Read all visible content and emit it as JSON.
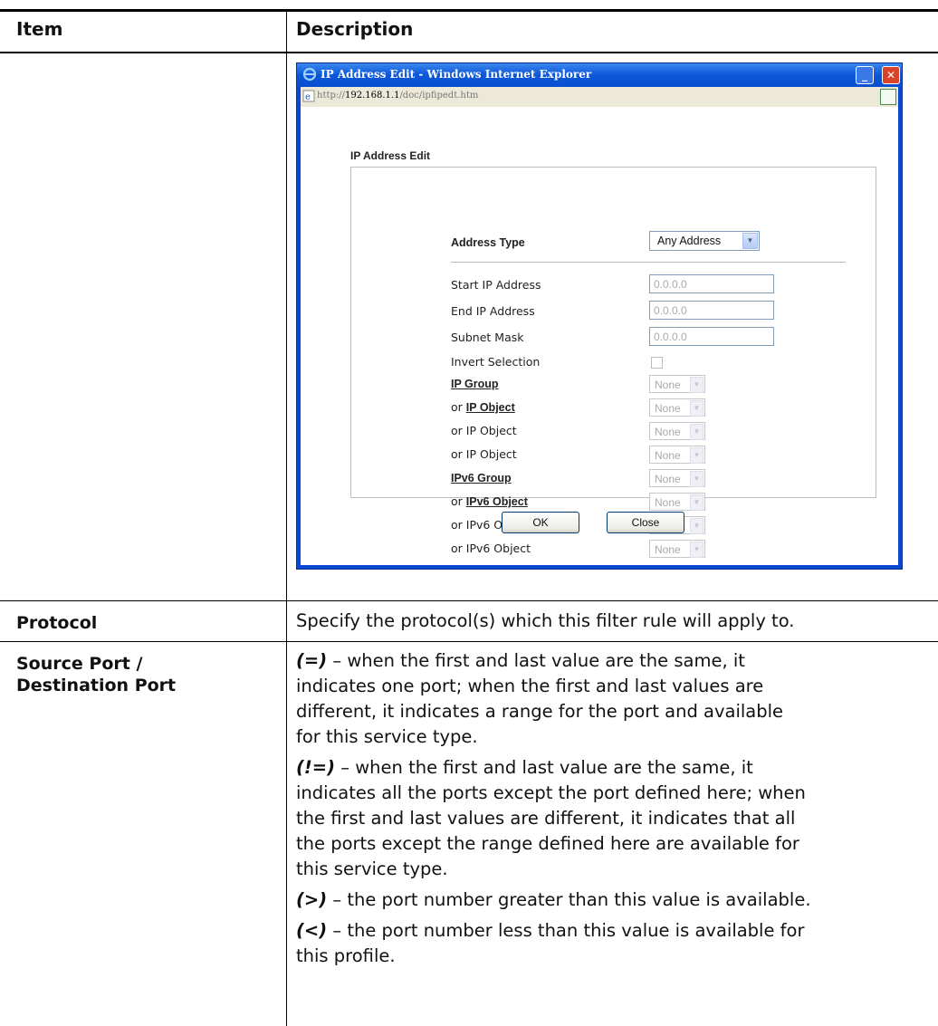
{
  "table": {
    "headers": [
      "Item",
      "Description"
    ],
    "rows": [
      {
        "item": "Protocol",
        "description": "Specify the protocol(s) which this filter rule will apply to."
      },
      {
        "item_lines": [
          "Source Port /",
          "Destination Port"
        ],
        "entries": [
          {
            "symbol": "(=)",
            "lines": [
              "– when the first and last value are the same, it",
              "indicates one port; when the first and last values are",
              "different, it indicates a range for the port and available",
              "for this service type."
            ]
          },
          {
            "symbol": "(!=)",
            "lines": [
              "– when the first and last value are the same, it",
              "indicates all the ports except the port defined here; when",
              "the first and last values are different, it indicates that all",
              "the ports except the range defined here are available for",
              "this service type."
            ]
          },
          {
            "symbol": "(>)",
            "lines": [
              "– the port number greater than this value is available."
            ]
          },
          {
            "symbol": "(<)",
            "lines": [
              "– the port number less than this value is available for",
              "this profile."
            ]
          }
        ]
      }
    ]
  },
  "ie_window": {
    "title": "IP Address Edit - Windows Internet Explorer",
    "url_prefix": "http://",
    "url_host": "192.168.1.1",
    "url_path": "/doc/ipfipedt.htm",
    "form_title": "IP Address Edit",
    "address_type_label": "Address Type",
    "address_type_value": "Any Address",
    "start_ip_label": "Start IP Address",
    "start_ip_value": "0.0.0.0",
    "end_ip_label": "End IP Address",
    "end_ip_value": "0.0.0.0",
    "subnet_label": "Subnet Mask",
    "subnet_value": "0.0.0.0",
    "invert_label": "Invert Selection",
    "ip_group_label": "IP Group",
    "or_prefix": "or",
    "ip_object_link": "IP Object",
    "ip_object_label": "or IP Object",
    "ipv6_group_label": "IPv6 Group",
    "ipv6_object_link": "IPv6 Object",
    "ipv6_object_label": "or IPv6 Object",
    "select_none": "None",
    "ok_label": "OK",
    "close_label": "Close"
  }
}
